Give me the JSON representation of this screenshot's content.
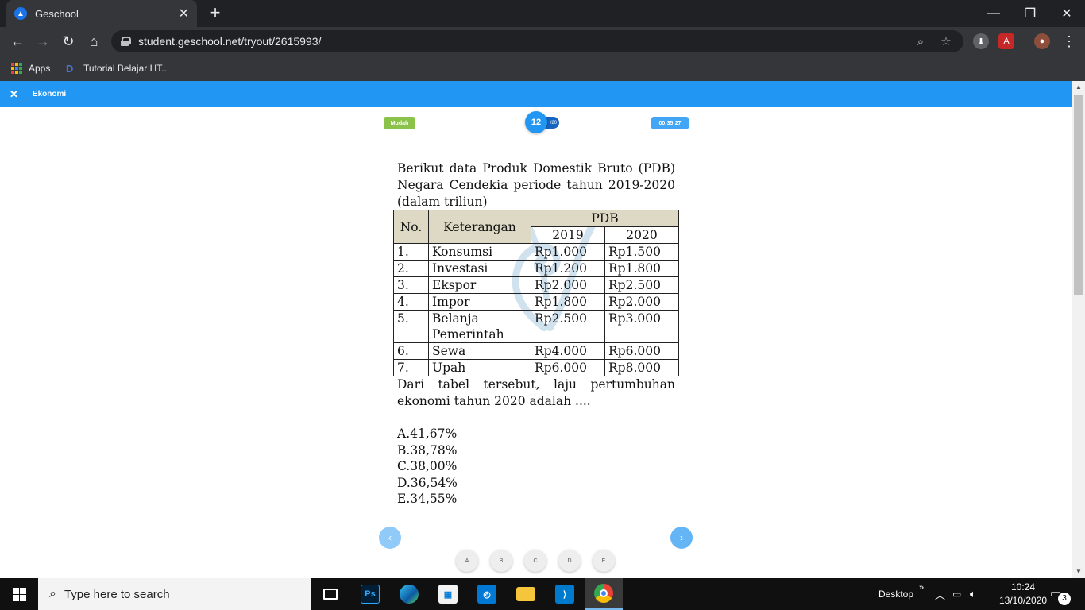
{
  "browser": {
    "tab_title": "Geschool",
    "tab_close": "✕",
    "new_tab": "+",
    "url": "student.geschool.net/tryout/2615993/",
    "bookmarks": [
      {
        "label": "Apps"
      },
      {
        "label": "Tutorial Belajar HT..."
      }
    ]
  },
  "appbar": {
    "close_label": "✕",
    "title": "Ekonomi"
  },
  "question_header": {
    "difficulty": "Mudah",
    "number": "12",
    "total": "/20",
    "timer": "00:35:27"
  },
  "question": {
    "intro": "Berikut data Produk Domestik Bruto (PDB) Negara Cendekia periode tahun 2019-2020 (dalam triliun)",
    "table": {
      "headers": {
        "no": "No.",
        "keterangan": "Keterangan",
        "pdb": "PDB",
        "y2019": "2019",
        "y2020": "2020"
      },
      "rows": [
        {
          "no": "1.",
          "ket": "Konsumsi",
          "v2019": "Rp1.000",
          "v2020": "Rp1.500"
        },
        {
          "no": "2.",
          "ket": "Investasi",
          "v2019": "Rp1.200",
          "v2020": "Rp1.800"
        },
        {
          "no": "3.",
          "ket": "Ekspor",
          "v2019": "Rp2.000",
          "v2020": "Rp2.500"
        },
        {
          "no": "4.",
          "ket": "Impor",
          "v2019": "Rp1.800",
          "v2020": "Rp2.000"
        },
        {
          "no": "5.",
          "ket": "Belanja Pemerintah",
          "v2019": "Rp2.500",
          "v2020": "Rp3.000"
        },
        {
          "no": "6.",
          "ket": "Sewa",
          "v2019": "Rp4.000",
          "v2020": "Rp6.000"
        },
        {
          "no": "7.",
          "ket": "Upah",
          "v2019": "Rp6.000",
          "v2020": "Rp8.000"
        }
      ]
    },
    "prompt": "Dari tabel tersebut, laju pertumbuhan ekonomi tahun 2020 adalah ....",
    "choices": [
      "A.41,67%",
      "B.38,78%",
      "C.38,00%",
      "D.36,54%",
      "E.34,55%"
    ]
  },
  "navigation": {
    "prev": "‹",
    "next": "›",
    "answers": [
      "A",
      "B",
      "C",
      "D",
      "E"
    ]
  },
  "taskbar": {
    "search_placeholder": "Type here to search",
    "desktop_label": "Desktop",
    "time": "10:24",
    "date": "13/10/2020",
    "notification_count": "3"
  }
}
